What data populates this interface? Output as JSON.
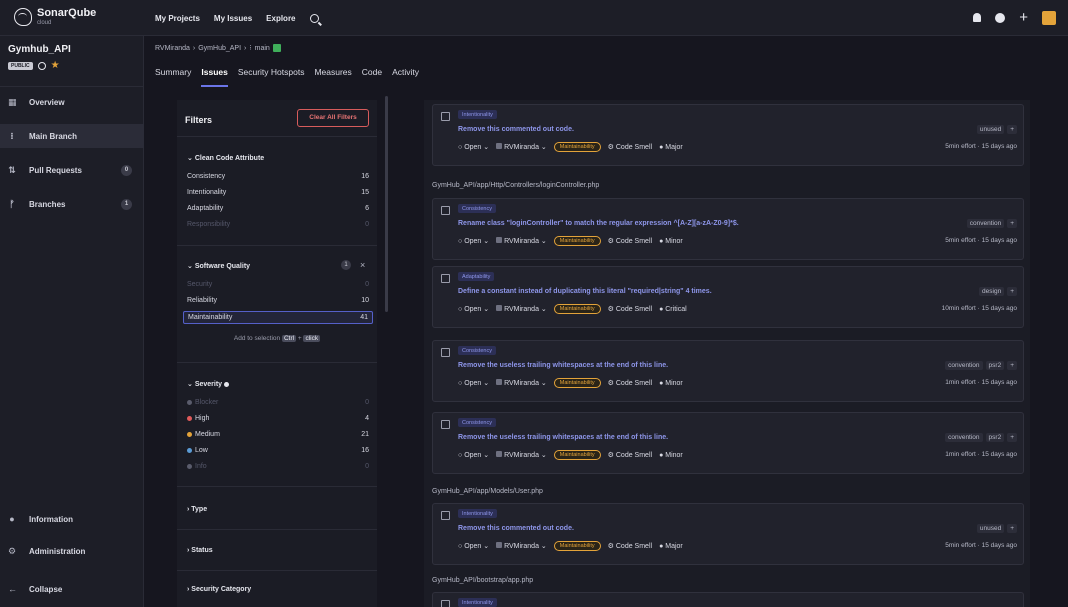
{
  "topbar": {
    "logo_name": "SonarQube",
    "logo_sub": "cloud",
    "nav": [
      "My Projects",
      "My Issues",
      "Explore"
    ]
  },
  "sidebar": {
    "project_name": "Gymhub_API",
    "public_badge": "PUBLIC",
    "items": [
      {
        "label": "Overview",
        "icon": "overview-icon"
      },
      {
        "label": "Main Branch",
        "icon": "branch-icon"
      },
      {
        "label": "Pull Requests",
        "icon": "pull-request-icon",
        "count": "0"
      },
      {
        "label": "Branches",
        "icon": "branches-icon",
        "count": "1"
      }
    ],
    "bottom": [
      {
        "label": "Information"
      },
      {
        "label": "Administration"
      },
      {
        "label": "Collapse"
      }
    ]
  },
  "breadcrumb": {
    "org": "RVMiranda",
    "project": "GymHub_API",
    "branch": "main"
  },
  "tabs": [
    "Summary",
    "Issues",
    "Security Hotspots",
    "Measures",
    "Code",
    "Activity"
  ],
  "filters": {
    "title": "Filters",
    "clear_label": "Clear All Filters",
    "clean_code": {
      "title": "Clean Code Attribute",
      "rows": [
        {
          "label": "Consistency",
          "count": "16"
        },
        {
          "label": "Intentionality",
          "count": "15"
        },
        {
          "label": "Adaptability",
          "count": "6"
        },
        {
          "label": "Responsibility",
          "count": "0"
        }
      ]
    },
    "software_quality": {
      "title": "Software Quality",
      "badge": "1",
      "rows": [
        {
          "label": "Security",
          "count": "0"
        },
        {
          "label": "Reliability",
          "count": "10"
        },
        {
          "label": "Maintainability",
          "count": "41"
        }
      ],
      "hint_prefix": "Add to selection",
      "hint_key1": "Ctrl",
      "hint_plus": "+",
      "hint_key2": "click"
    },
    "severity": {
      "title": "Severity",
      "rows": [
        {
          "label": "Blocker",
          "count": "0",
          "color": "#5a5c6c"
        },
        {
          "label": "High",
          "count": "4",
          "color": "#e05a5a"
        },
        {
          "label": "Medium",
          "count": "21",
          "color": "#e3a33a"
        },
        {
          "label": "Low",
          "count": "16",
          "color": "#5b9bd5"
        },
        {
          "label": "Info",
          "count": "0",
          "color": "#5a5c6c"
        }
      ]
    },
    "collapsed": [
      "Type",
      "Status",
      "Security Category"
    ]
  },
  "issues": {
    "groups": [
      {
        "path": ""
      },
      {
        "path": "GymHub_API/app/Http/Controllers/loginController.php"
      },
      {
        "path": "GymHub_API/app/Models/User.php"
      },
      {
        "path": "GymHub_API/bootstrap/app.php"
      }
    ],
    "cards": [
      {
        "attr": "Intentionality",
        "message": "Remove this commented out code.",
        "status": "Open",
        "assignee": "RVMiranda",
        "quality": "Maintainability",
        "type": "Code Smell",
        "severity": "Major",
        "tags": [
          "unused",
          "+"
        ],
        "effort": "5min effort",
        "age": "15 days ago"
      },
      {
        "attr": "Consistency",
        "message": "Rename class \"loginController\" to match the regular expression ^[A-Z][a-zA-Z0-9]*$.",
        "status": "Open",
        "assignee": "RVMiranda",
        "quality": "Maintainability",
        "type": "Code Smell",
        "severity": "Minor",
        "tags": [
          "convention",
          "+"
        ],
        "effort": "5min effort",
        "age": "15 days ago"
      },
      {
        "attr": "Adaptability",
        "message": "Define a constant instead of duplicating this literal \"required|string\" 4 times.",
        "status": "Open",
        "assignee": "RVMiranda",
        "quality": "Maintainability",
        "type": "Code Smell",
        "severity": "Critical",
        "tags": [
          "design",
          "+"
        ],
        "effort": "10min effort",
        "age": "15 days ago"
      },
      {
        "attr": "Consistency",
        "message": "Remove the useless trailing whitespaces at the end of this line.",
        "status": "Open",
        "assignee": "RVMiranda",
        "quality": "Maintainability",
        "type": "Code Smell",
        "severity": "Minor",
        "tags": [
          "convention",
          "psr2",
          "+"
        ],
        "effort": "1min effort",
        "age": "15 days ago"
      },
      {
        "attr": "Consistency",
        "message": "Remove the useless trailing whitespaces at the end of this line.",
        "status": "Open",
        "assignee": "RVMiranda",
        "quality": "Maintainability",
        "type": "Code Smell",
        "severity": "Minor",
        "tags": [
          "convention",
          "psr2",
          "+"
        ],
        "effort": "1min effort",
        "age": "15 days ago"
      },
      {
        "attr": "Intentionality",
        "message": "Remove this commented out code.",
        "status": "Open",
        "assignee": "RVMiranda",
        "quality": "Maintainability",
        "type": "Code Smell",
        "severity": "Major",
        "tags": [
          "unused",
          "+"
        ],
        "effort": "5min effort",
        "age": "15 days ago"
      },
      {
        "attr": "Intentionality"
      }
    ]
  }
}
